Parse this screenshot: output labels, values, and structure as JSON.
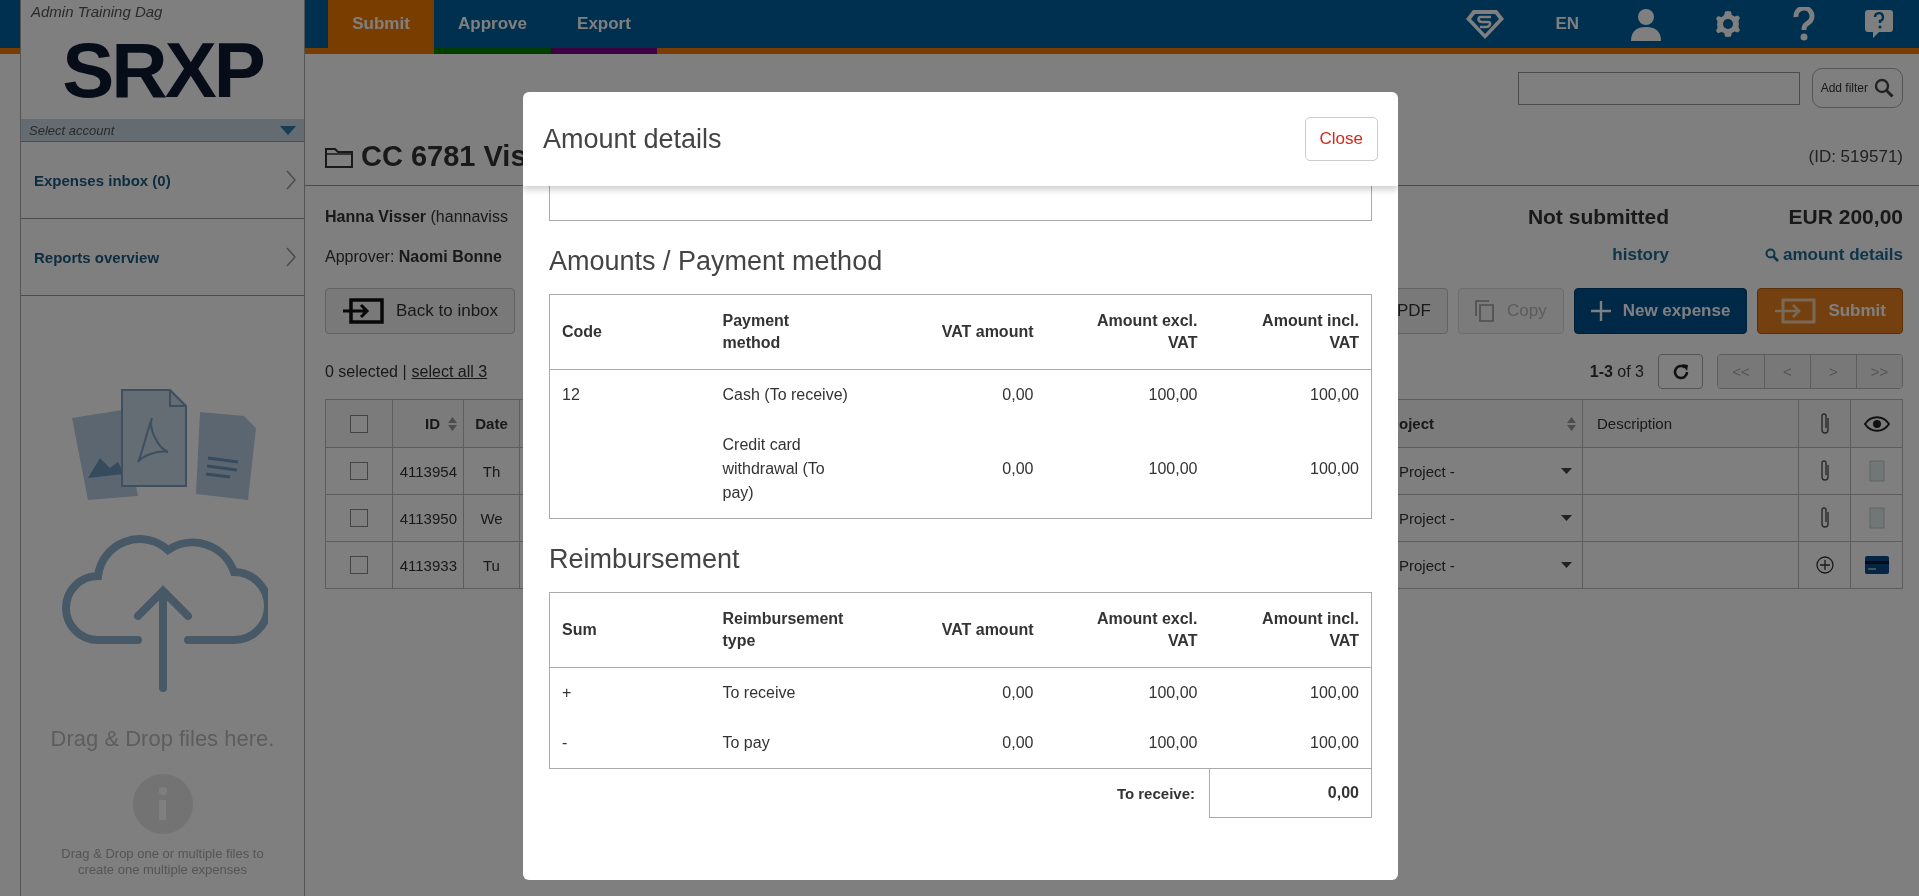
{
  "top_bar": {
    "tabs": [
      {
        "label": "Submit",
        "selected": true
      },
      {
        "label": "Approve",
        "selected": false
      },
      {
        "label": "Export",
        "selected": false
      }
    ],
    "language": "EN"
  },
  "sidebar": {
    "account_name": "Admin Training Dag",
    "logo": "SRXP",
    "account_select": "Select account",
    "items": [
      {
        "label": "Expenses inbox (0)"
      },
      {
        "label": "Reports overview"
      }
    ],
    "drop_title": "Drag & Drop files here.",
    "drop_hint": "Drag & Drop one or multiple files to create one multiple expenses"
  },
  "filter_button": "Add filter",
  "report": {
    "title": "CC 6781 Vis",
    "id": "(ID: 519571)",
    "owner": "**Hanna Visser** (hannaviss",
    "approver": "Approver: **Naomi Bonne**",
    "status": "Not submitted",
    "total": "EUR 200,00",
    "links": [
      {
        "label": "history",
        "kind": "plain"
      },
      {
        "label": "amount details",
        "kind": "search"
      }
    ]
  },
  "toolbar_left": [
    {
      "label": "Back to inbox",
      "kind": "back",
      "disabled": false
    }
  ],
  "toolbar_right": [
    {
      "label": "PDF",
      "kind": "pdf",
      "disabled": false
    },
    {
      "label": "Copy",
      "kind": "copy",
      "disabled": true
    },
    {
      "label": "New expense",
      "kind": "new",
      "disabled": false
    },
    {
      "label": "Submit",
      "kind": "submit",
      "disabled": false
    }
  ],
  "selection": {
    "count": "0 selected |",
    "select_all": "select all 3"
  },
  "pagination": {
    "range": "**1-3** of 3",
    "pages": [
      "<<",
      "<",
      ">",
      ">>"
    ]
  },
  "table": {
    "select_all_checked": false,
    "columns": [
      "ID",
      "Date",
      "oject",
      "Description"
    ],
    "rows": [
      {
        "checked": false,
        "id": "4113954",
        "date": "Th",
        "project": "Project -",
        "attachment": {
          "kind": "clip"
        },
        "preview": {
          "kind": "receipt"
        }
      },
      {
        "checked": false,
        "id": "4113950",
        "date": "We",
        "project": "Project -",
        "attachment": {
          "kind": "clip"
        },
        "preview": {
          "kind": "receipt"
        }
      },
      {
        "checked": false,
        "id": "4113933",
        "date": "Tu",
        "project": "Project -",
        "attachment": {
          "kind": "add"
        },
        "preview": {
          "kind": "card"
        }
      }
    ]
  },
  "modal": {
    "title": "Amount details",
    "close": "Close",
    "sections": [
      {
        "heading": "Amounts / Payment method",
        "columns": [
          "Code",
          "Payment method",
          "VAT amount",
          "Amount excl. VAT",
          "Amount incl. VAT"
        ],
        "rows": [
          [
            "12",
            "Cash (To receive)",
            "0,00",
            "100,00",
            "100,00"
          ],
          [
            null,
            "Credit card withdrawal (To pay)",
            "0,00",
            "100,00",
            "100,00"
          ]
        ]
      },
      {
        "heading": "Reimbursement",
        "columns": [
          "Sum",
          "Reimbursement type",
          "VAT amount",
          "Amount excl. VAT",
          "Amount incl. VAT"
        ],
        "rows": [
          [
            "+",
            "To receive",
            "0,00",
            "100,00",
            "100,00"
          ],
          [
            "-",
            "To pay",
            "0,00",
            "100,00",
            "100,00"
          ]
        ],
        "total": {
          "label": "To receive:",
          "value": "0,00"
        }
      }
    ]
  }
}
